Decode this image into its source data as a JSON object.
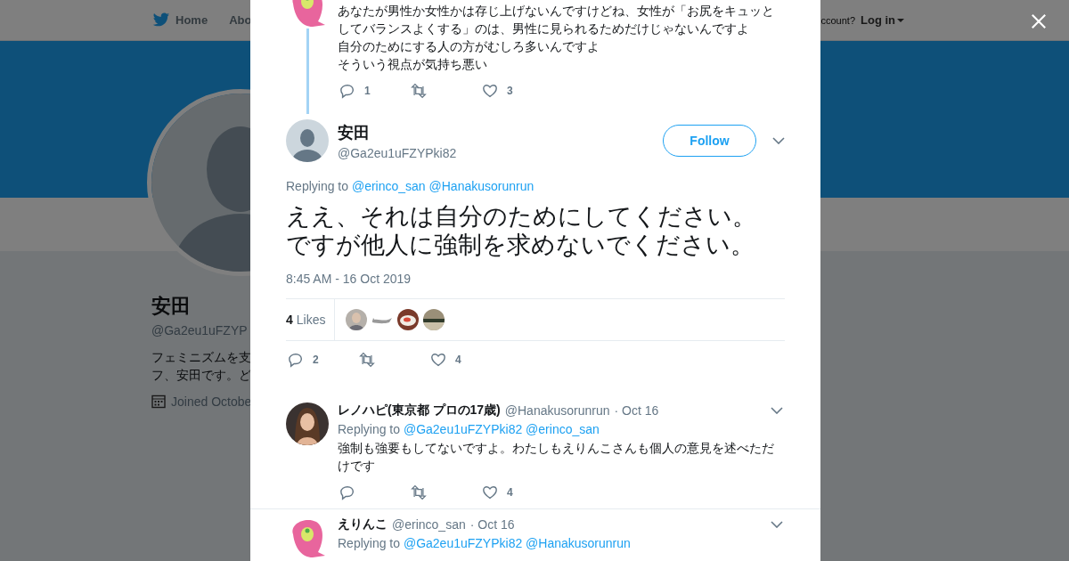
{
  "nav": {
    "home": "Home",
    "about": "Abo",
    "account_prompt": "ccount?",
    "login": "Log in"
  },
  "profile": {
    "name": "安田",
    "handle": "@Ga2eu1uFZYP",
    "bio": "フェミニズムを支フ、安田です。ど",
    "joined": "Joined Octobe"
  },
  "tweets": [
    {
      "kind": "parent",
      "paragraphs": [
        "あなたが男性か女性かは存じ上げないんですけどね、女性が「お尻をキュッとしてバランスよくする」のは、男性に見られるためだけじゃないんですよ",
        "自分のためにする人の方がむしろ多いんですよ",
        "そういう視点が気持ち悪い"
      ],
      "actions": {
        "replies": "1",
        "likes": "3"
      }
    },
    {
      "kind": "focus",
      "name": "安田",
      "handle": "@Ga2eu1uFZYPki82",
      "follow": "Follow",
      "replying_label": "Replying to",
      "mentions": [
        "@erinco_san",
        "@Hanakusorunrun"
      ],
      "text": "ええ、それは自分のためにしてください。ですが他人に強制を求めないでください。",
      "timestamp": "8:45 AM - 16 Oct 2019",
      "likes_count": "4",
      "likes_label": "Likes",
      "likers": [
        {
          "kind": "picture"
        },
        {
          "kind": "picture"
        },
        {
          "kind": "picture"
        },
        {
          "kind": "picture"
        }
      ],
      "actions": {
        "replies": "2",
        "likes": "4"
      }
    },
    {
      "kind": "reply",
      "name": "レノハピ(東京都 プロの17歳)",
      "handle": "@Hanakusorunrun",
      "date": "· Oct 16",
      "replying_label": "Replying to",
      "mentions": [
        "@Ga2eu1uFZYPki82",
        "@erinco_san"
      ],
      "text": "強制も強要もしてないですよ。わたしもえりんこさんも個人の意見を述べただけです",
      "actions": {
        "likes": "4"
      }
    },
    {
      "kind": "reply",
      "name": "えりんこ",
      "handle": "@erinco_san",
      "date": "· Oct 16",
      "replying_label": "Replying to",
      "mentions": [
        "@Ga2eu1uFZYPki82",
        "@Hanakusorunrun"
      ]
    }
  ]
}
